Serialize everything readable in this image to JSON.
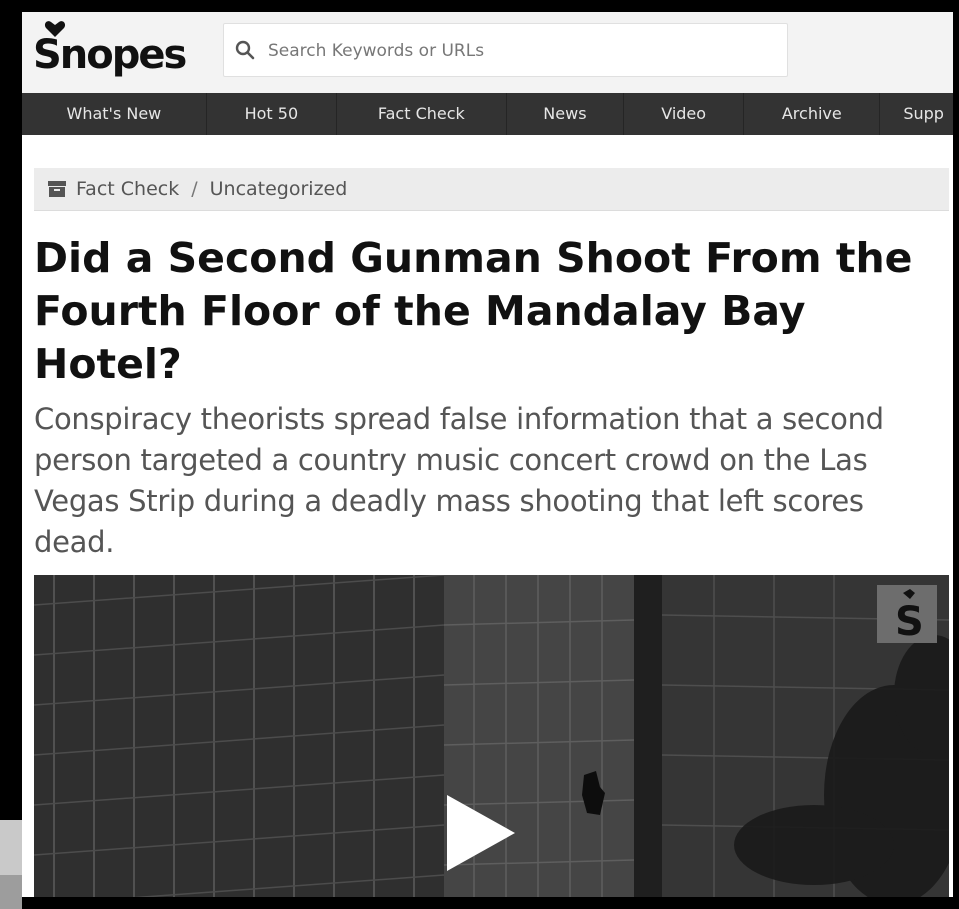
{
  "brand": {
    "name": "Snopes"
  },
  "search": {
    "placeholder": "Search Keywords or URLs"
  },
  "nav": {
    "items": [
      "What's New",
      "Hot 50",
      "Fact Check",
      "News",
      "Video",
      "Archive",
      "Supp"
    ]
  },
  "breadcrumb": {
    "section": "Fact Check",
    "separator": "/",
    "category": "Uncategorized"
  },
  "article": {
    "title": "Did a Second Gunman Shoot From the Fourth Floor of the Mandalay Bay Hotel?",
    "subtitle": "Conspiracy theorists spread false information that a second person targeted a country music concert crowd on the Las Vegas Strip during a deadly mass shooting that left scores dead."
  },
  "video": {
    "play_icon": "play-icon",
    "watermark_icon": "snopes-logo-icon"
  },
  "colors": {
    "nav_bg": "#333333",
    "header_bg": "#f3f3f3",
    "breadcrumb_bg": "#ececec",
    "title": "#111111",
    "subtitle": "#555555"
  }
}
